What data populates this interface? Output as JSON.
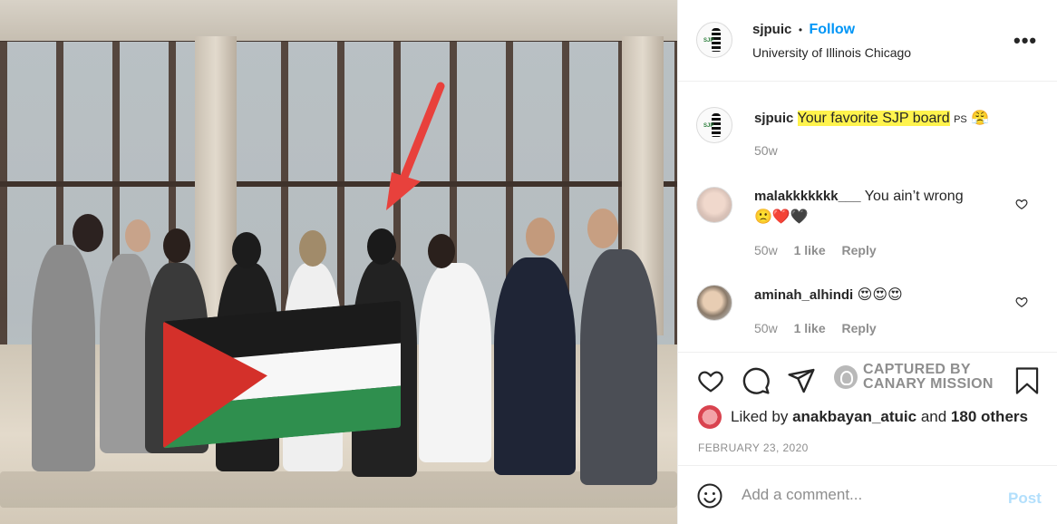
{
  "post": {
    "username": "sjpuic",
    "follow_label": "Follow",
    "separator": "•",
    "location": "University of Illinois Chicago",
    "more_label": "•••"
  },
  "caption": {
    "username": "sjpuic",
    "text": "Your favorite SJP board",
    "suffix": "PS",
    "emoji": "😤",
    "time": "50w"
  },
  "comments": [
    {
      "username": "malakkkkkkk___",
      "text": "You ain’t wrong",
      "emoji": "🙁❤️🖤",
      "time": "50w",
      "likes": "1 like",
      "reply": "Reply"
    },
    {
      "username": "aminah_alhindi",
      "text": "",
      "emoji": "😍😍😍",
      "time": "50w",
      "likes": "1 like",
      "reply": "Reply"
    }
  ],
  "watermark": {
    "line1": "CAPTURED BY",
    "line2": "CANARY MISSION"
  },
  "likes": {
    "prefix": "Liked by",
    "user": "anakbayan_atuic",
    "conj": "and",
    "others": "180 others"
  },
  "date": "FEBRUARY 23, 2020",
  "add_comment": {
    "placeholder": "Add a comment...",
    "post_label": "Post"
  },
  "icons": {
    "like": "heart-icon",
    "comment": "comment-icon",
    "share": "paper-plane-icon",
    "save": "bookmark-icon",
    "emoji": "smiley-icon"
  },
  "colors": {
    "accent": "#0095f6",
    "post_disabled": "#b2dffc",
    "highlight": "#fff34d",
    "arrow": "#e8413c"
  }
}
